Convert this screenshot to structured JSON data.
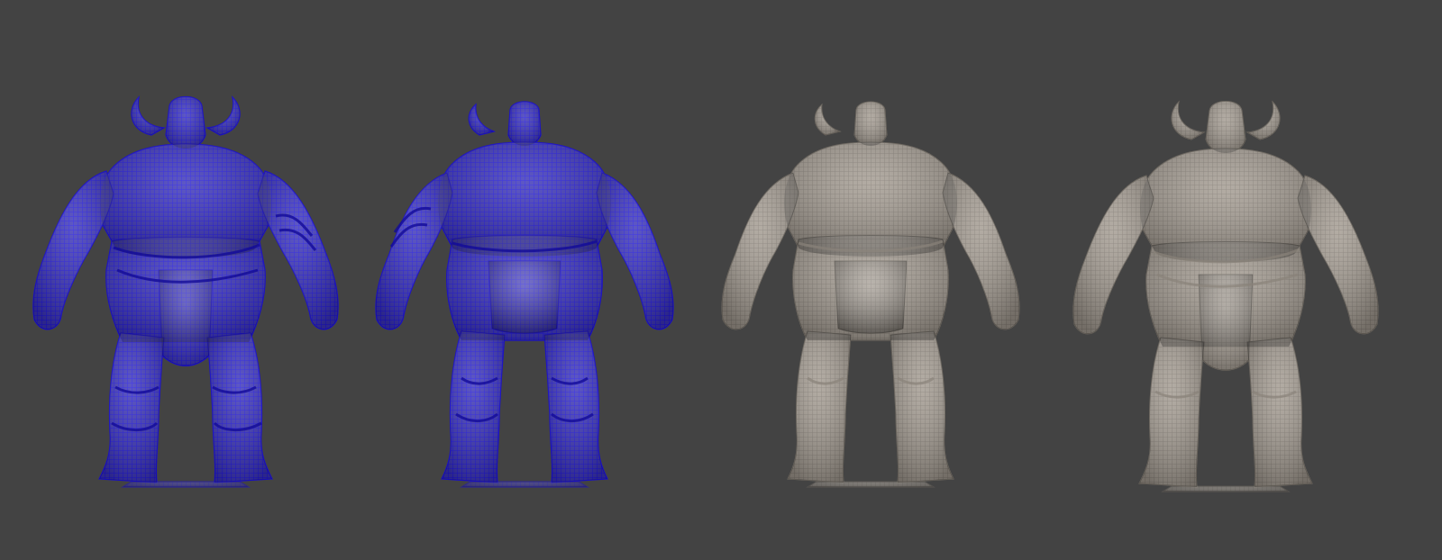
{
  "viewport": {
    "background": "#434343",
    "models": [
      {
        "name": "ogre-front",
        "view": "front",
        "shading": "wireframe",
        "color": "#2a1fd6"
      },
      {
        "name": "ogre-back",
        "view": "back",
        "shading": "wireframe",
        "color": "#2a1fd6"
      },
      {
        "name": "ogre-back",
        "view": "back",
        "shading": "clay",
        "color": "#a59d93"
      },
      {
        "name": "ogre-front",
        "view": "front",
        "shading": "clay",
        "color": "#a59d93"
      }
    ]
  }
}
